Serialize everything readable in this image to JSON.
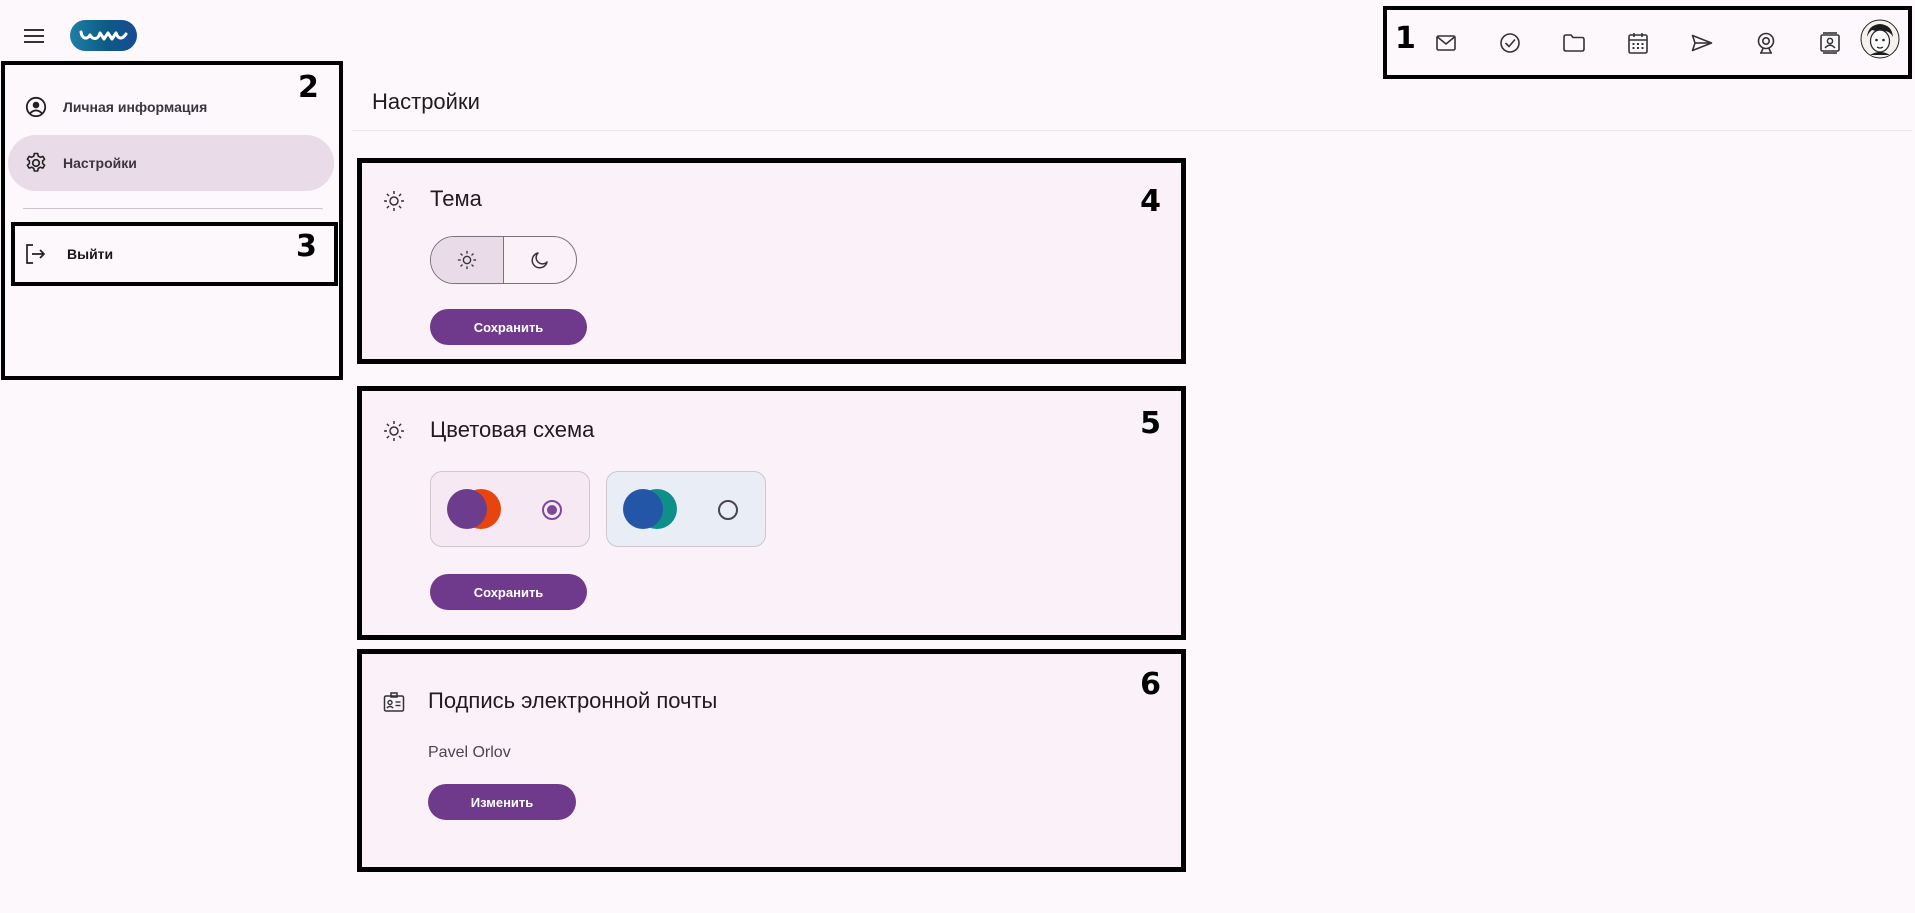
{
  "header": {
    "menu_icon": "menu-icon",
    "logo_icon": "app-logo",
    "toolbar_region": "1",
    "toolbar_icons": [
      "mail-icon",
      "tasks-check-icon",
      "folder-icon",
      "calendar-icon",
      "send-icon",
      "webcam-icon",
      "contacts-icon"
    ],
    "avatar": "user-avatar"
  },
  "sidebar": {
    "region": "2",
    "items": [
      {
        "label": "Личная информация",
        "icon": "account-circle-icon"
      },
      {
        "label": "Настройки",
        "icon": "gear-icon",
        "active": true
      }
    ],
    "logout": {
      "label": "Выйти",
      "icon": "logout-icon",
      "region": "3"
    }
  },
  "main": {
    "title": "Настройки",
    "theme_card": {
      "region": "4",
      "title": "Тема",
      "icon": "sun-icon",
      "options": [
        "light-sun-icon",
        "dark-moon-icon"
      ],
      "selected": "light",
      "save_label": "Сохранить"
    },
    "scheme_card": {
      "region": "5",
      "title": "Цветовая схема",
      "icon": "sun-icon",
      "schemes": [
        {
          "colors": [
            "#6c3d8c",
            "#e8440e"
          ],
          "background": "#f6e9f3",
          "selected": true
        },
        {
          "colors": [
            "#2456a8",
            "#0f8f8a"
          ],
          "background": "#e9edf5",
          "selected": false
        }
      ],
      "save_label": "Сохранить"
    },
    "signature_card": {
      "region": "6",
      "title": "Подпись электронной почты",
      "icon": "id-card-icon",
      "signature": "Pavel Orlov",
      "edit_label": "Изменить"
    }
  },
  "colors": {
    "accent": "#6f3a8c",
    "page_bg": "#fdf8fc",
    "card_bg": "#fbf1f9",
    "active_nav_bg": "#eadbe8"
  }
}
